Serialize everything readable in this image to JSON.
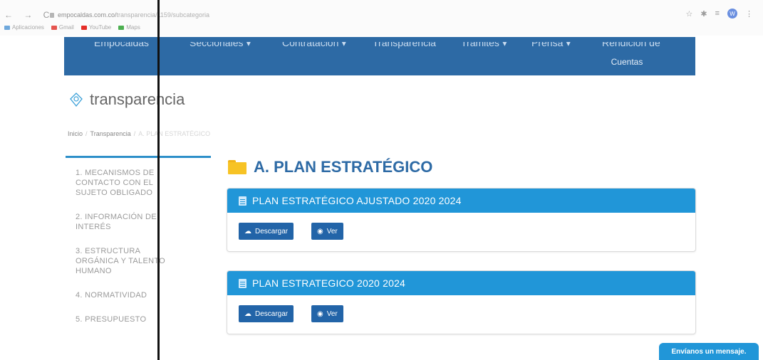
{
  "browser": {
    "nav_glyphs": "← → C",
    "url_host": "empocaldas.com.co/",
    "url_path": "transparencia/1159/subcategoria",
    "avatar_letter": "W",
    "star_icon": "☆",
    "bookmarks": [
      {
        "label": "Aplicaciones",
        "color": "#6fa8dc"
      },
      {
        "label": "Gmail",
        "color": "#e5554f"
      },
      {
        "label": "YouTube",
        "color": "#e52d27"
      },
      {
        "label": "Maps",
        "color": "#4caf50"
      }
    ]
  },
  "site_nav": {
    "items": [
      "Empocaldas",
      "Seccionales ▾",
      "Contratación ▾",
      "Transparencia",
      "Trámites ▾",
      "Prensa ▾",
      "Rendición de"
    ],
    "sub_label": "Cuentas",
    "color": "#2d6aa5"
  },
  "logo": {
    "text": "transparencia"
  },
  "breadcrumb": {
    "items": [
      "Inicio",
      "Transparencia"
    ],
    "current": "A. PLAN ESTRATÉGICO"
  },
  "sidebar": {
    "items": [
      "1. MECANISMOS DE CONTACTO CON EL SUJETO OBLIGADO",
      "2. INFORMACIÓN DE INTERÉS",
      "3. ESTRUCTURA ORGÁNICA Y TALENTO HUMANO",
      "4. NORMATIVIDAD",
      "5. PRESUPUESTO"
    ]
  },
  "main": {
    "title": "A. PLAN ESTRATÉGICO",
    "cards": [
      {
        "title": "PLAN ESTRATÉGICO AJUSTADO 2020 2024",
        "download_label": "Descargar",
        "view_label": "Ver"
      },
      {
        "title": "PLAN ESTRATEGICO 2020 2024",
        "download_label": "Descargar",
        "view_label": "Ver"
      }
    ]
  },
  "chat": {
    "label": "Envíanos un mensaje."
  },
  "colors": {
    "header_blue": "#2196d8",
    "button_blue": "#2264a8",
    "folder_yellow": "#f7c325"
  }
}
